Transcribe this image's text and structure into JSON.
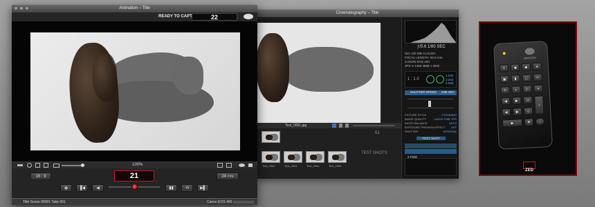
{
  "back_window": {
    "title": "Cinematography – Title",
    "histogram_readout": "ƒ/5.6  1/80 SEC",
    "camera_info": [
      "ISO 100  WB CLOUDY",
      "FOCAL LENGTH: 50.0 mm",
      "CANON EOS 400",
      "JPG  S 1468  3888 x 2592"
    ],
    "right_values": [
      "1.532",
      "1.243",
      "0.948"
    ],
    "exposure_label": "1 : 1.0",
    "shutter_label": "SHUTTER SPEED",
    "shutter_value": "1/80 SEC",
    "settings": [
      {
        "label": "PICTURE STYLE",
        "value": "STANDARD"
      },
      {
        "label": "IMAGE QUALITY",
        "value": "LARGE FINE JPG"
      },
      {
        "label": "WHITE BALANCE",
        "value": "AUTO"
      },
      {
        "label": "EXPOSURE PREVIEW EFFECT",
        "value": "OFF"
      },
      {
        "label": "SHUTTER",
        "value": "INTERVAL"
      }
    ],
    "test_shot_button": "TEST SHOT",
    "list_rows": [
      "1  1",
      "2 Field"
    ],
    "filmstrip_file": "Test_0001.jpg",
    "take_number": "01",
    "test_shots_label": "TEST SHOTS",
    "thumb_labels": [
      "Test_0002",
      "Test_0003",
      "Test_0004",
      "Test_0005",
      "Test_0006"
    ]
  },
  "front_window": {
    "title": "Animation – Title",
    "ready_label": "READY TO CAPTURE:",
    "ready_count": "22",
    "zoom": "100%",
    "aspect_ratio": "16 : 9",
    "frame_counter": "21",
    "fps_value": "24",
    "fps_unit": "FPS",
    "status_left": "Title  Scene 00001  Take 001",
    "status_right": "Canon EOS 400"
  },
  "keypad": {
    "brand": "DRAGON",
    "logo_text": "ZED"
  },
  "colors": {
    "accent_red": "#c8171a",
    "keypad_frame": "#7a0a0a",
    "panel_blue": "#2a5a8a"
  }
}
